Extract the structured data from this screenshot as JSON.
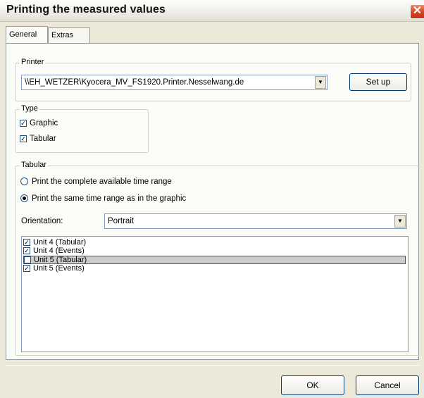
{
  "window": {
    "title": "Printing the measured values"
  },
  "tabs": [
    "General",
    "Extras"
  ],
  "printer": {
    "group_label": "Printer",
    "selected": "\\\\EH_WETZER\\Kyocera_MV_FS1920.Printer.Nesselwang.de",
    "setup_label": "Set up"
  },
  "type": {
    "group_label": "Type",
    "options": [
      {
        "label": "Graphic",
        "checked": true
      },
      {
        "label": "Tabular",
        "checked": true
      }
    ]
  },
  "tabular": {
    "group_label": "Tabular",
    "radios": [
      {
        "label": "Print the complete available time range",
        "selected": false
      },
      {
        "label": "Print the same time range as in the graphic",
        "selected": true
      }
    ],
    "orientation_label": "Orientation:",
    "orientation_value": "Portrait",
    "units": [
      {
        "label": "Unit 4 (Tabular)",
        "checked": true
      },
      {
        "label": "Unit 4 (Events)",
        "checked": true
      },
      {
        "label": "Unit 5 (Tabular)",
        "checked": false,
        "selected": true
      },
      {
        "label": "Unit 5 (Events)",
        "checked": true
      }
    ]
  },
  "buttons": {
    "ok": "OK",
    "cancel": "Cancel"
  },
  "icons": {
    "close": "close-icon",
    "dropdown": "chevron-down-icon",
    "check": "checkmark-icon"
  }
}
